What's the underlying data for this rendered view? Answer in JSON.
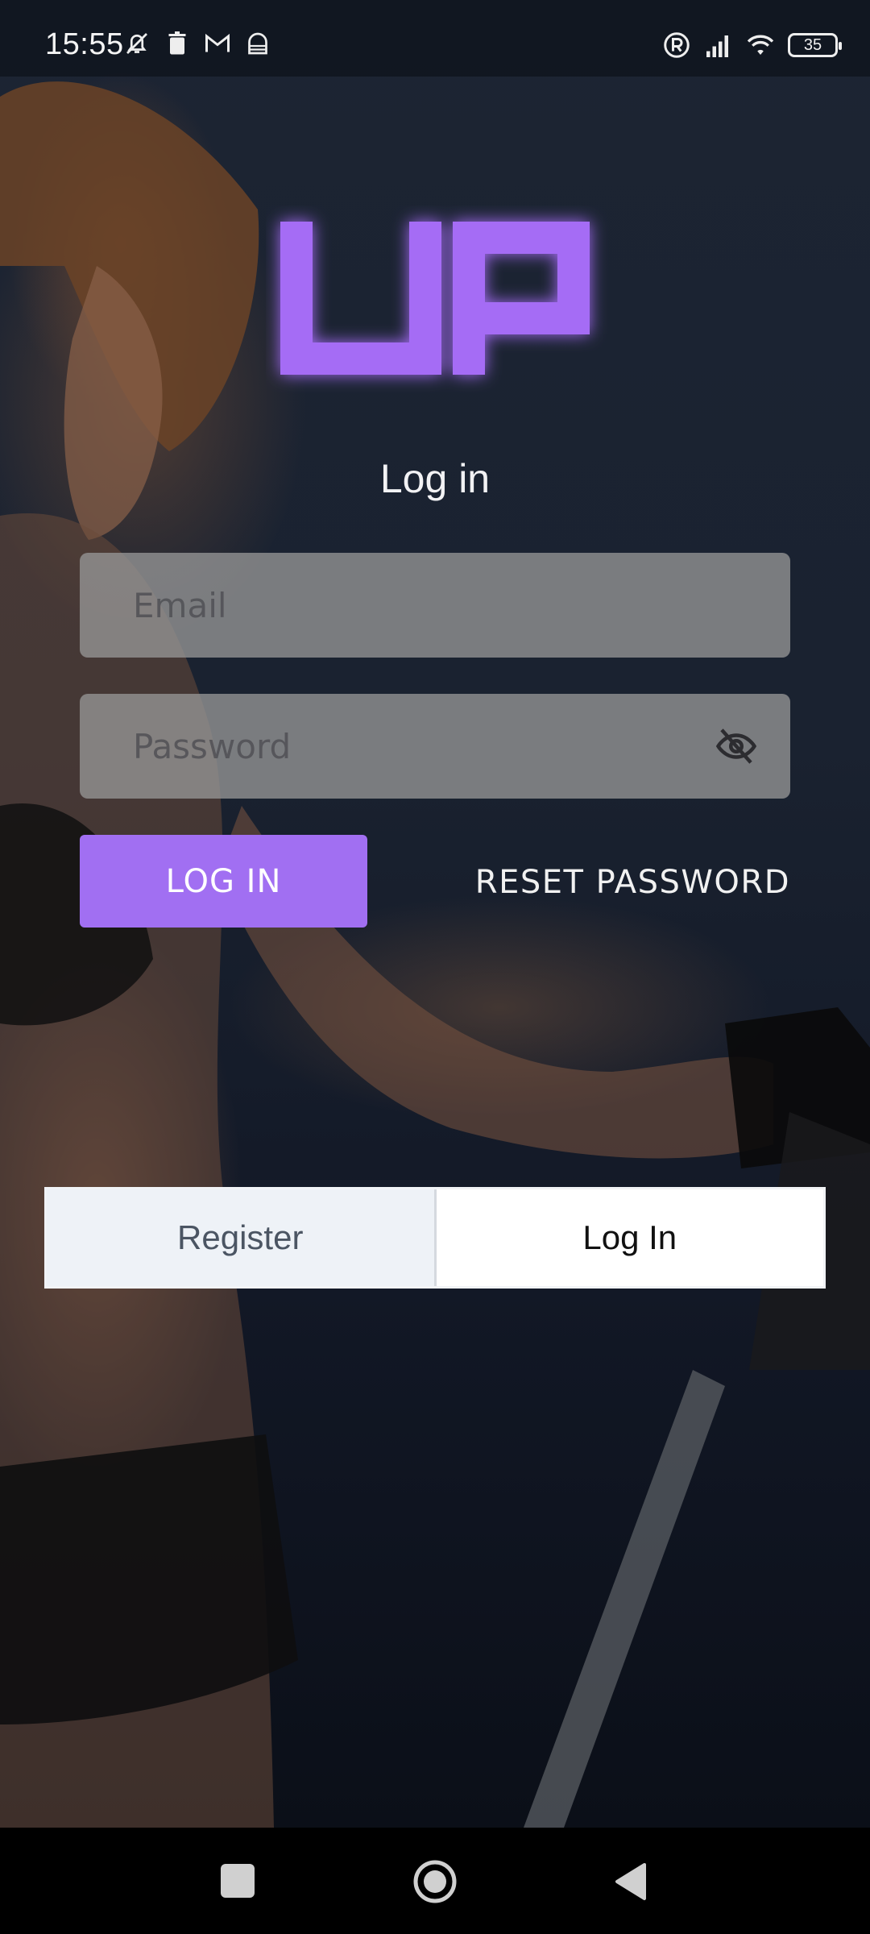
{
  "status_bar": {
    "time": "15:55",
    "battery": "35",
    "icons_left": [
      "mute-icon",
      "trash-icon",
      "gmail-icon",
      "vpn-icon"
    ],
    "icons_right": [
      "registered-icon",
      "signal-icon",
      "wifi-icon",
      "battery-icon"
    ]
  },
  "brand": {
    "logo_text": "UP",
    "accent": "#a16ff2"
  },
  "form": {
    "title": "Log in",
    "email_placeholder": "Email",
    "email_value": "",
    "password_placeholder": "Password",
    "password_value": "",
    "login_button": "LOG IN",
    "reset_button": "RESET PASSWORD"
  },
  "toggle": {
    "register_label": "Register",
    "login_label": "Log In",
    "selected": "Log In"
  },
  "nav": {
    "buttons": [
      "recent-apps",
      "home",
      "back"
    ]
  }
}
